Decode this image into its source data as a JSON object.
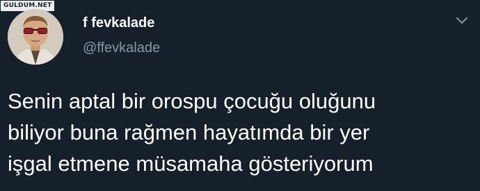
{
  "watermark": {
    "text": "GULDUM.NET"
  },
  "account": {
    "display_name": "f fevkalade",
    "handle": "@ffevkalade"
  },
  "tweet": {
    "lines": [
      "Senin aptal bir orospu çocuğu oluğunu",
      "biliyor buna rağmen hayatımda bir yer",
      "işgal etmene müsamaha gösteriyorum"
    ]
  },
  "icons": {
    "more": "chevron-down-icon",
    "avatar": "profile-photo"
  },
  "colors": {
    "background": "#15202b",
    "text": "#ffffff",
    "secondary_text": "#8899a6"
  }
}
